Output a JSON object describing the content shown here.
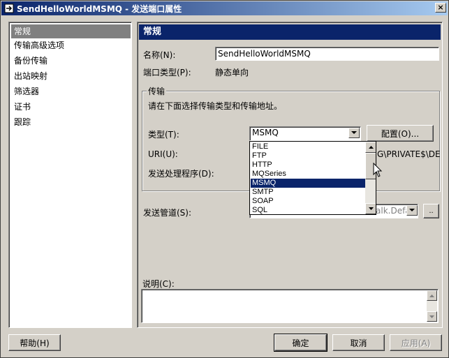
{
  "window": {
    "title": "SendHelloWorldMSMQ - 发送端口属性",
    "close_label": "×"
  },
  "nav": {
    "items": [
      {
        "label": "常规",
        "selected": true
      },
      {
        "label": "传输高级选项",
        "selected": false
      },
      {
        "label": "备份传输",
        "selected": false
      },
      {
        "label": "出站映射",
        "selected": false
      },
      {
        "label": "筛选器",
        "selected": false
      },
      {
        "label": "证书",
        "selected": false
      },
      {
        "label": "跟踪",
        "selected": false
      }
    ]
  },
  "general": {
    "header": "常规",
    "name_label": "名称(N):",
    "name_value": "SendHelloWorldMSMQ",
    "port_type_label": "端口类型(P):",
    "port_type_value": "静态单向"
  },
  "transport": {
    "group_title": "传输",
    "instruction": "请在下面选择传输类型和传输地址。",
    "type_label": "类型(T):",
    "type_value": "MSMQ",
    "configure_label": "配置(O)...",
    "uri_label": "URI(U):",
    "uri_value_partial": "G\\PRIVATE$\\DE",
    "handler_label": "发送处理程序(D):",
    "options": [
      "FILE",
      "FTP",
      "HTTP",
      "MQSeries",
      "MSMQ",
      "SMTP",
      "SOAP",
      "SQL"
    ],
    "selected_option": "MSMQ"
  },
  "pipeline": {
    "label": "发送管道(S):",
    "value_partial": "alk.Defau",
    "browse_label": ".."
  },
  "description": {
    "label": "说明(C):",
    "value": ""
  },
  "buttons": {
    "help": "帮助(H)",
    "ok": "确定",
    "cancel": "取消",
    "apply": "应用(A)"
  }
}
